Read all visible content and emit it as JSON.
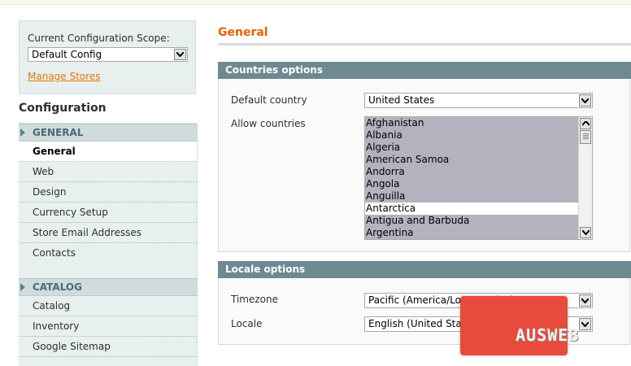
{
  "scope": {
    "label": "Current Configuration Scope:",
    "selected": "Default Config",
    "manage_link": "Manage Stores"
  },
  "sidebar": {
    "title": "Configuration",
    "sections": [
      {
        "label": "GENERAL",
        "items": [
          "General",
          "Web",
          "Design",
          "Currency Setup",
          "Store Email Addresses",
          "Contacts"
        ]
      },
      {
        "label": "CATALOG",
        "items": [
          "Catalog",
          "Inventory",
          "Google Sitemap"
        ]
      }
    ]
  },
  "main": {
    "title": "General",
    "countries": {
      "heading": "Countries options",
      "default_country_label": "Default country",
      "default_country_value": "United States",
      "allow_countries_label": "Allow countries",
      "allow_countries_options": [
        "Afghanistan",
        "Albania",
        "Algeria",
        "American Samoa",
        "Andorra",
        "Angola",
        "Anguilla",
        "Antarctica",
        "Antigua and Barbuda",
        "Argentina"
      ],
      "unselected_option": "Antarctica"
    },
    "locale": {
      "heading": "Locale options",
      "timezone_label": "Timezone",
      "timezone_value": "Pacific (America/Los_Angeles)",
      "locale_label": "Locale",
      "locale_value": "English (United States)"
    }
  },
  "watermark": {
    "text": "AUSWEB"
  },
  "colors": {
    "accent": "#eb5e00",
    "fieldset_header": "#6f8992",
    "sidebar_bg": "#e7efef",
    "selected_option": "#b3b3bf"
  }
}
